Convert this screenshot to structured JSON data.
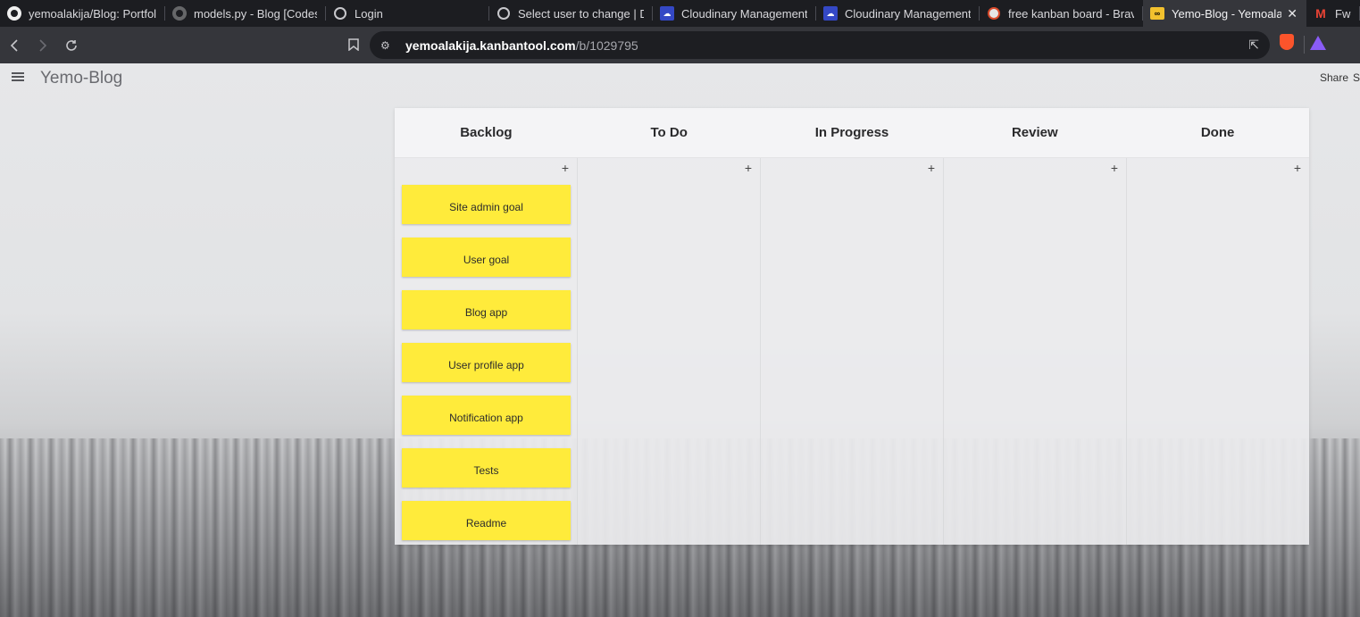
{
  "browser": {
    "tabs": [
      {
        "title": "yemoalakija/Blog: Portfolio (",
        "icon": "github-icon",
        "active": false
      },
      {
        "title": "models.py - Blog [Codespa",
        "icon": "github-icon",
        "active": false
      },
      {
        "title": "Login",
        "icon": "globe-icon",
        "active": false
      },
      {
        "title": "Select user to change | Djan",
        "icon": "globe-icon",
        "active": false
      },
      {
        "title": "Cloudinary Management Co",
        "icon": "cloudinary-icon",
        "active": false
      },
      {
        "title": "Cloudinary Management Co",
        "icon": "cloudinary-icon",
        "active": false
      },
      {
        "title": "free kanban board - Brave S",
        "icon": "brave-search-icon",
        "active": false
      },
      {
        "title": "Yemo-Blog - Yemoalaki",
        "icon": "kanbantool-icon",
        "active": true
      },
      {
        "title": "Fwd:",
        "icon": "gmail-icon",
        "active": false
      }
    ],
    "close_tab_glyph": "✕",
    "url_host": "yemoalakija.kanbantool.com",
    "url_path": "/b/1029795"
  },
  "app": {
    "board_name": "Yemo-Blog",
    "share_label": "Share",
    "share_label_cut": "S"
  },
  "board": {
    "add_glyph": "+",
    "columns": [
      {
        "name": "Backlog",
        "cards": [
          "Site admin goal",
          "User goal",
          "Blog app",
          "User profile app",
          "Notification app",
          "Tests",
          "Readme"
        ]
      },
      {
        "name": "To Do",
        "cards": []
      },
      {
        "name": "In Progress",
        "cards": []
      },
      {
        "name": "Review",
        "cards": []
      },
      {
        "name": "Done",
        "cards": []
      }
    ]
  },
  "colors": {
    "card": "#ffeb3b",
    "tab_active": "#35363b",
    "brave_orange": "#fb542b"
  }
}
